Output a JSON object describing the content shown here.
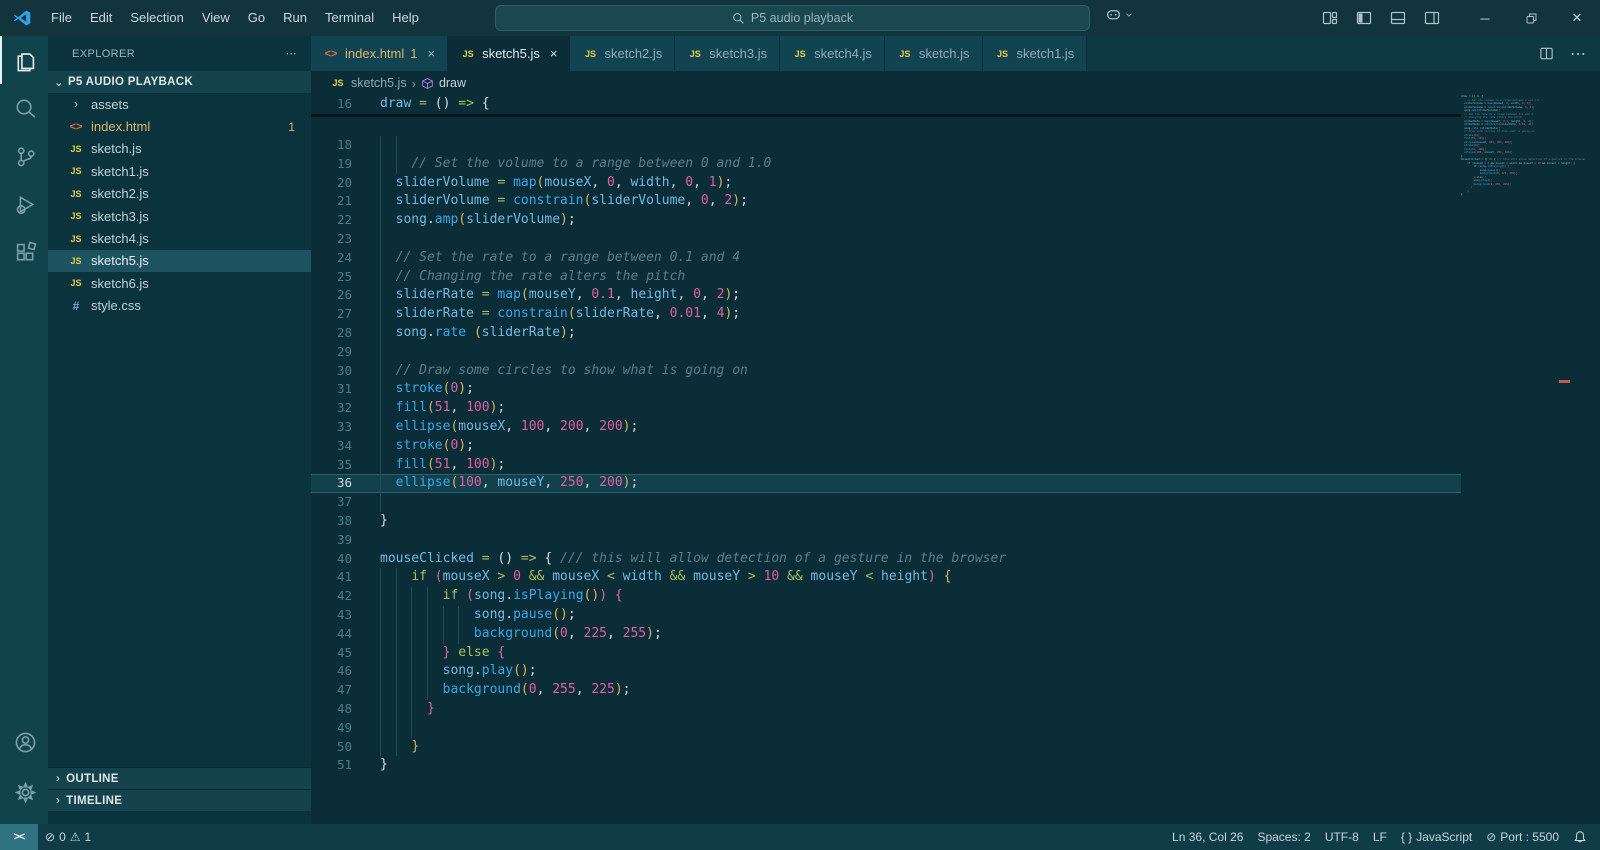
{
  "colors": {
    "titlebar_bg": "#11343d",
    "editor_bg": "#0a2d37",
    "sidebar_bg": "#0b333d",
    "activitybar_bg": "#11434d",
    "statusbar_bg": "#0f3c46",
    "remote_bg": "#2f7380",
    "accent_blue": "#39a8e8",
    "variable_blue": "#74b9e2",
    "keyword_green": "#a9bf5f",
    "number_pink": "#e0619f",
    "comment_gray": "#5c7f8d",
    "bracket_gold": "#d9b65c",
    "bracket_pink": "#d967ad",
    "warning_gold": "#d9b670",
    "logo_blue": "#2da4e8",
    "symbol_purple": "#b180d7",
    "warn_mark": "#c05a40"
  },
  "titlebar": {
    "menus": [
      "File",
      "Edit",
      "Selection",
      "View",
      "Go",
      "Run",
      "Terminal",
      "Help"
    ],
    "search": "P5 audio playback",
    "window_controls": [
      "minimize",
      "maximize",
      "close"
    ]
  },
  "activity_bar": {
    "top": [
      {
        "id": "explorer",
        "active": true
      },
      {
        "id": "search",
        "active": false
      },
      {
        "id": "source-control",
        "active": false
      },
      {
        "id": "run-debug",
        "active": false
      },
      {
        "id": "extensions",
        "active": false
      }
    ],
    "bottom": [
      {
        "id": "account"
      },
      {
        "id": "settings"
      }
    ]
  },
  "explorer": {
    "title": "EXPLORER",
    "project": "P5 AUDIO PLAYBACK",
    "icons": {
      "js": "JS",
      "html": "<>",
      "css": "#",
      "chevron_right": "›",
      "chevron_down": "⌄"
    },
    "files": [
      {
        "name": "assets",
        "icon": "chevron_right",
        "kind": "folder"
      },
      {
        "name": "index.html",
        "icon": "html",
        "badge": "1",
        "warn": true
      },
      {
        "name": "sketch.js",
        "icon": "js"
      },
      {
        "name": "sketch1.js",
        "icon": "js"
      },
      {
        "name": "sketch2.js",
        "icon": "js"
      },
      {
        "name": "sketch3.js",
        "icon": "js"
      },
      {
        "name": "sketch4.js",
        "icon": "js"
      },
      {
        "name": "sketch5.js",
        "icon": "js",
        "selected": true
      },
      {
        "name": "sketch6.js",
        "icon": "js"
      },
      {
        "name": "style.css",
        "icon": "css"
      }
    ],
    "sections": [
      "OUTLINE",
      "TIMELINE"
    ]
  },
  "tabs": [
    {
      "label": "index.html",
      "icon": "html",
      "badge": "1",
      "close": "×",
      "active": false,
      "warn": true
    },
    {
      "label": "sketch5.js",
      "icon": "js",
      "close": "×",
      "active": true
    },
    {
      "label": "sketch2.js",
      "icon": "js",
      "active": false
    },
    {
      "label": "sketch3.js",
      "icon": "js",
      "active": false
    },
    {
      "label": "sketch4.js",
      "icon": "js",
      "active": false
    },
    {
      "label": "sketch.js",
      "icon": "js",
      "active": false
    },
    {
      "label": "sketch1.js",
      "icon": "js",
      "active": false
    }
  ],
  "breadcrumb": {
    "file": "sketch5.js",
    "separator": "›",
    "symbol": "draw"
  },
  "editor": {
    "sticky_line": {
      "n": 16,
      "i": 0,
      "t": [
        [
          "v",
          "draw"
        ],
        [
          "t",
          " "
        ],
        [
          "k",
          "="
        ],
        [
          "t",
          " "
        ],
        [
          "bw",
          "()"
        ],
        [
          "t",
          " "
        ],
        [
          "k",
          "=>"
        ],
        [
          "t",
          " "
        ],
        [
          "bw",
          "{"
        ]
      ]
    },
    "lines": [
      {
        "n": 18,
        "i": 0,
        "g": 2,
        "t": []
      },
      {
        "n": 19,
        "i": 4,
        "t": [
          [
            "c",
            "// Set the volume to a range between 0 and 1.0"
          ]
        ]
      },
      {
        "n": 20,
        "i": 2,
        "t": [
          [
            "v",
            "sliderVolume"
          ],
          [
            "k",
            " = "
          ],
          [
            "f",
            "map"
          ],
          [
            "bg",
            "("
          ],
          [
            "v",
            "mouseX"
          ],
          [
            "p",
            ", "
          ],
          [
            "n",
            "0"
          ],
          [
            "p",
            ", "
          ],
          [
            "v",
            "width"
          ],
          [
            "p",
            ", "
          ],
          [
            "n",
            "0"
          ],
          [
            "p",
            ", "
          ],
          [
            "n",
            "1"
          ],
          [
            "bg",
            ")"
          ],
          [
            "p",
            ";"
          ]
        ]
      },
      {
        "n": 21,
        "i": 2,
        "t": [
          [
            "v",
            "sliderVolume"
          ],
          [
            "k",
            " = "
          ],
          [
            "f",
            "constrain"
          ],
          [
            "bg",
            "("
          ],
          [
            "v",
            "sliderVolume"
          ],
          [
            "p",
            ", "
          ],
          [
            "n",
            "0"
          ],
          [
            "p",
            ", "
          ],
          [
            "n",
            "2"
          ],
          [
            "bg",
            ")"
          ],
          [
            "p",
            ";"
          ]
        ]
      },
      {
        "n": 22,
        "i": 2,
        "t": [
          [
            "v",
            "song"
          ],
          [
            "p",
            "."
          ],
          [
            "f",
            "amp"
          ],
          [
            "bg",
            "("
          ],
          [
            "v",
            "sliderVolume"
          ],
          [
            "bg",
            ")"
          ],
          [
            "p",
            ";"
          ]
        ]
      },
      {
        "n": 23,
        "i": 0,
        "g": 1,
        "t": []
      },
      {
        "n": 24,
        "i": 2,
        "t": [
          [
            "c",
            "// Set the rate to a range between 0.1 and 4"
          ]
        ]
      },
      {
        "n": 25,
        "i": 2,
        "t": [
          [
            "c",
            "// Changing the rate alters the pitch"
          ]
        ]
      },
      {
        "n": 26,
        "i": 2,
        "t": [
          [
            "v",
            "sliderRate"
          ],
          [
            "k",
            " = "
          ],
          [
            "f",
            "map"
          ],
          [
            "bg",
            "("
          ],
          [
            "v",
            "mouseY"
          ],
          [
            "p",
            ", "
          ],
          [
            "n",
            "0.1"
          ],
          [
            "p",
            ", "
          ],
          [
            "v",
            "height"
          ],
          [
            "p",
            ", "
          ],
          [
            "n",
            "0"
          ],
          [
            "p",
            ", "
          ],
          [
            "n",
            "2"
          ],
          [
            "bg",
            ")"
          ],
          [
            "p",
            ";"
          ]
        ]
      },
      {
        "n": 27,
        "i": 2,
        "t": [
          [
            "v",
            "sliderRate"
          ],
          [
            "k",
            " = "
          ],
          [
            "f",
            "constrain"
          ],
          [
            "bg",
            "("
          ],
          [
            "v",
            "sliderRate"
          ],
          [
            "p",
            ", "
          ],
          [
            "n",
            "0.01"
          ],
          [
            "p",
            ", "
          ],
          [
            "n",
            "4"
          ],
          [
            "bg",
            ")"
          ],
          [
            "p",
            ";"
          ]
        ]
      },
      {
        "n": 28,
        "i": 2,
        "t": [
          [
            "v",
            "song"
          ],
          [
            "p",
            "."
          ],
          [
            "f",
            "rate"
          ],
          [
            "t",
            " "
          ],
          [
            "bg",
            "("
          ],
          [
            "v",
            "sliderRate"
          ],
          [
            "bg",
            ")"
          ],
          [
            "p",
            ";"
          ]
        ]
      },
      {
        "n": 29,
        "i": 0,
        "g": 1,
        "t": []
      },
      {
        "n": 30,
        "i": 2,
        "t": [
          [
            "c",
            "// Draw some circles to show what is going on"
          ]
        ]
      },
      {
        "n": 31,
        "i": 2,
        "t": [
          [
            "f",
            "stroke"
          ],
          [
            "bg",
            "("
          ],
          [
            "n",
            "0"
          ],
          [
            "bg",
            ")"
          ],
          [
            "p",
            ";"
          ]
        ]
      },
      {
        "n": 32,
        "i": 2,
        "t": [
          [
            "f",
            "fill"
          ],
          [
            "bg",
            "("
          ],
          [
            "n",
            "51"
          ],
          [
            "p",
            ", "
          ],
          [
            "n",
            "100"
          ],
          [
            "bg",
            ")"
          ],
          [
            "p",
            ";"
          ]
        ]
      },
      {
        "n": 33,
        "i": 2,
        "t": [
          [
            "f",
            "ellipse"
          ],
          [
            "bg",
            "("
          ],
          [
            "v",
            "mouseX"
          ],
          [
            "p",
            ", "
          ],
          [
            "n",
            "100"
          ],
          [
            "p",
            ", "
          ],
          [
            "n",
            "200"
          ],
          [
            "p",
            ", "
          ],
          [
            "n",
            "200"
          ],
          [
            "bg",
            ")"
          ],
          [
            "p",
            ";"
          ]
        ]
      },
      {
        "n": 34,
        "i": 2,
        "t": [
          [
            "f",
            "stroke"
          ],
          [
            "bg",
            "("
          ],
          [
            "n",
            "0"
          ],
          [
            "bg",
            ")"
          ],
          [
            "p",
            ";"
          ]
        ]
      },
      {
        "n": 35,
        "i": 2,
        "t": [
          [
            "f",
            "fill"
          ],
          [
            "bg",
            "("
          ],
          [
            "n",
            "51"
          ],
          [
            "p",
            ", "
          ],
          [
            "n",
            "100"
          ],
          [
            "bg",
            ")"
          ],
          [
            "p",
            ";"
          ]
        ]
      },
      {
        "n": 36,
        "i": 2,
        "cur": true,
        "t": [
          [
            "f",
            "ellipse"
          ],
          [
            "bg",
            "("
          ],
          [
            "n",
            "100"
          ],
          [
            "p",
            ", "
          ],
          [
            "v",
            "mouseY"
          ],
          [
            "p",
            ", "
          ],
          [
            "n",
            "250"
          ],
          [
            "p",
            ", "
          ],
          [
            "n",
            "200"
          ],
          [
            "bg",
            ")"
          ],
          [
            "p",
            ";"
          ]
        ]
      },
      {
        "n": 37,
        "i": 0,
        "g": 1,
        "t": []
      },
      {
        "n": 38,
        "i": 0,
        "t": [
          [
            "bw",
            "}"
          ]
        ]
      },
      {
        "n": 39,
        "i": 0,
        "g": 0,
        "t": []
      },
      {
        "n": 40,
        "i": 0,
        "t": [
          [
            "v",
            "mouseClicked"
          ],
          [
            "k",
            " = "
          ],
          [
            "bw",
            "()"
          ],
          [
            "t",
            " "
          ],
          [
            "k",
            "=>"
          ],
          [
            "t",
            " "
          ],
          [
            "bw",
            "{"
          ],
          [
            "t",
            " "
          ],
          [
            "c",
            "/// this will allow detection of a gesture in the browser"
          ]
        ]
      },
      {
        "n": 41,
        "i": 4,
        "t": [
          [
            "k",
            "if"
          ],
          [
            "t",
            " "
          ],
          [
            "bp",
            "("
          ],
          [
            "v",
            "mouseX"
          ],
          [
            "k",
            " > "
          ],
          [
            "n",
            "0"
          ],
          [
            "k",
            " && "
          ],
          [
            "v",
            "mouseX"
          ],
          [
            "k",
            " < "
          ],
          [
            "v",
            "width"
          ],
          [
            "k",
            " && "
          ],
          [
            "v",
            "mouseY"
          ],
          [
            "k",
            " > "
          ],
          [
            "n",
            "10"
          ],
          [
            "k",
            " && "
          ],
          [
            "v",
            "mouseY"
          ],
          [
            "k",
            " < "
          ],
          [
            "v",
            "height"
          ],
          [
            "bp",
            ")"
          ],
          [
            "t",
            " "
          ],
          [
            "bg",
            "{"
          ]
        ]
      },
      {
        "n": 42,
        "i": 8,
        "t": [
          [
            "k",
            "if"
          ],
          [
            "t",
            " "
          ],
          [
            "bp",
            "("
          ],
          [
            "v",
            "song"
          ],
          [
            "p",
            "."
          ],
          [
            "f",
            "isPlaying"
          ],
          [
            "bg",
            "()"
          ],
          [
            "bp",
            ")"
          ],
          [
            "t",
            " "
          ],
          [
            "bp",
            "{"
          ]
        ]
      },
      {
        "n": 43,
        "i": 12,
        "t": [
          [
            "v",
            "song"
          ],
          [
            "p",
            "."
          ],
          [
            "f",
            "pause"
          ],
          [
            "bg",
            "()"
          ],
          [
            "p",
            ";"
          ]
        ]
      },
      {
        "n": 44,
        "i": 12,
        "t": [
          [
            "f",
            "background"
          ],
          [
            "bg",
            "("
          ],
          [
            "n",
            "0"
          ],
          [
            "p",
            ", "
          ],
          [
            "n",
            "225"
          ],
          [
            "p",
            ", "
          ],
          [
            "n",
            "255"
          ],
          [
            "bg",
            ")"
          ],
          [
            "p",
            ";"
          ]
        ]
      },
      {
        "n": 45,
        "i": 8,
        "t": [
          [
            "bp",
            "}"
          ],
          [
            "t",
            " "
          ],
          [
            "k",
            "else"
          ],
          [
            "t",
            " "
          ],
          [
            "bp",
            "{"
          ]
        ]
      },
      {
        "n": 46,
        "i": 8,
        "t": [
          [
            "v",
            "song"
          ],
          [
            "p",
            "."
          ],
          [
            "f",
            "play"
          ],
          [
            "bg",
            "()"
          ],
          [
            "p",
            ";"
          ]
        ]
      },
      {
        "n": 47,
        "i": 8,
        "t": [
          [
            "f",
            "background"
          ],
          [
            "bg",
            "("
          ],
          [
            "n",
            "0"
          ],
          [
            "p",
            ", "
          ],
          [
            "n",
            "255"
          ],
          [
            "p",
            ", "
          ],
          [
            "n",
            "225"
          ],
          [
            "bg",
            ")"
          ],
          [
            "p",
            ";"
          ]
        ]
      },
      {
        "n": 48,
        "i": 6,
        "t": [
          [
            "bp",
            "}"
          ]
        ]
      },
      {
        "n": 49,
        "i": 0,
        "g": 3,
        "t": []
      },
      {
        "n": 50,
        "i": 4,
        "t": [
          [
            "bg",
            "}"
          ]
        ]
      },
      {
        "n": 51,
        "i": 0,
        "t": [
          [
            "bw",
            "}"
          ]
        ]
      }
    ]
  },
  "status_bar": {
    "remote": "><",
    "errors": "0",
    "warnings": "1",
    "cursor": "Ln 36, Col 26",
    "indentation": "Spaces: 2",
    "encoding": "UTF-8",
    "eol": "LF",
    "language": "JavaScript",
    "port": "Port : 5500"
  }
}
